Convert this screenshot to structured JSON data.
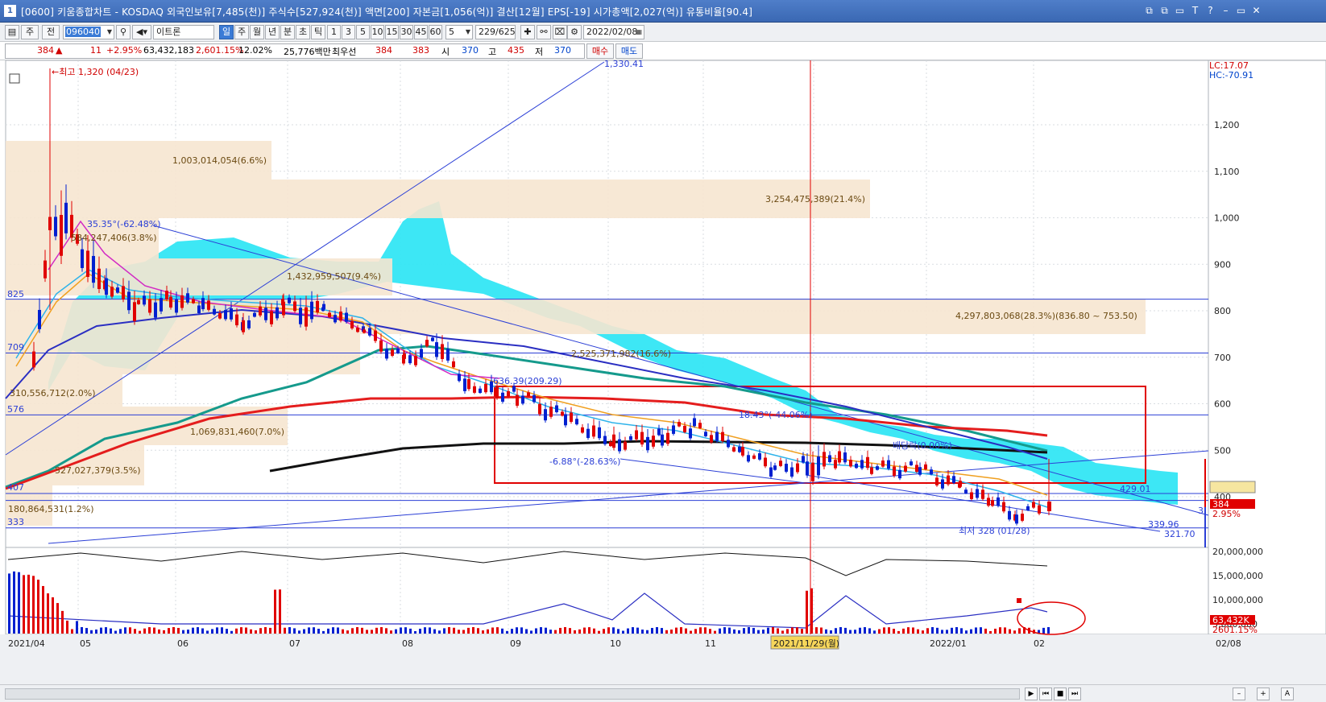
{
  "window": {
    "title": "[0600] 키움종합차트 - KOSDAQ 외국인보유[7,485(천)] 주식수[527,924(천)] 액면[200] 자본금[1,056(억)] 결산[12월] EPS[-19] 시가총액[2,027(억)] 유통비율[90.4]",
    "icon_label": "1",
    "buttons": [
      "⧉",
      "⧉",
      "▭",
      "T",
      "?",
      "–",
      "▭",
      "✕"
    ]
  },
  "toolbar": {
    "period_unit": "주",
    "period_prev": "전",
    "stock_code": "096040",
    "stock_name": "이트론",
    "intervals": [
      "일",
      "주",
      "월",
      "년",
      "분",
      "초",
      "틱"
    ],
    "selected_interval": "일",
    "tick_values": [
      "1",
      "3",
      "5",
      "10",
      "15",
      "30",
      "45",
      "60"
    ],
    "count_value": "5",
    "range_value": "229/625",
    "date_value": "2022/02/08"
  },
  "quote": {
    "price": "384",
    "change_arrow": "▲",
    "change": "11",
    "change_pct": "+2.95%",
    "volume": "63,432,183",
    "volume_ratio": "2,601.15%",
    "turnover": "12.02%",
    "amount": "25,776백만",
    "best_bid_label": "최우선",
    "ask": "384",
    "bid": "383",
    "open_label": "시",
    "open": "370",
    "high_label": "고",
    "high": "435",
    "low_label": "저",
    "low": "370",
    "buy_button": "매수",
    "sell_button": "매도"
  },
  "chart": {
    "lc_label": "LC:17.07",
    "hc_label": "HC:-70.91",
    "price_ticks": [
      "1,200",
      "1,100",
      "1,000",
      "900",
      "800",
      "700",
      "600",
      "500",
      "400"
    ],
    "volume_ticks": [
      "20,000,000",
      "15,000,000",
      "10,000,000",
      "5,000,000"
    ],
    "date_ticks": [
      "2021/04",
      "05",
      "06",
      "07",
      "08",
      "09",
      "10",
      "11",
      "2021/11/29(월)",
      "2022/01",
      "02",
      "02/08"
    ],
    "current_price_tag": "384",
    "current_pct_tag": "2.95%",
    "volume_tag": "63,432K",
    "volume_pct_tag": "2601.15%",
    "annotations": {
      "high_label": "←최고 1,320 (04/23)",
      "low_label": "최저 328 (01/28)",
      "trend_top": "1,330.41",
      "left_825": "825",
      "left_709": "709",
      "left_576": "576",
      "left_407": "407",
      "left_333": "333",
      "vol_1": "1,003,014,054(6.6%)",
      "vol_2": "3,254,475,389(21.4%)",
      "vol_3": "584,247,406(3.8%)",
      "vol_4": "1,432,959,507(9.4%)",
      "vol_5": "4,297,803,068(28.3%)(836.80 ~ 753.50)",
      "vol_6": "2,525,371,982(16.6%)",
      "vol_7": "310,556,712(2.0%)",
      "vol_8": "1,069,831,460(7.0%)",
      "vol_9": "527,027,379(3.5%)",
      "vol_10": "180,864,531(1.2%)",
      "pct_1": "35.35°(-62.48%)",
      "pct_2": "636.39(209.29)",
      "pct_3": "18.43°(-44.06%)",
      "pct_4": "-6.88°(-28.63%)",
      "pct_5": "배당락(0.00%)",
      "level_1": "429.01",
      "level_2": "339.96",
      "level_3": "321.70",
      "level_4": "3"
    }
  }
}
